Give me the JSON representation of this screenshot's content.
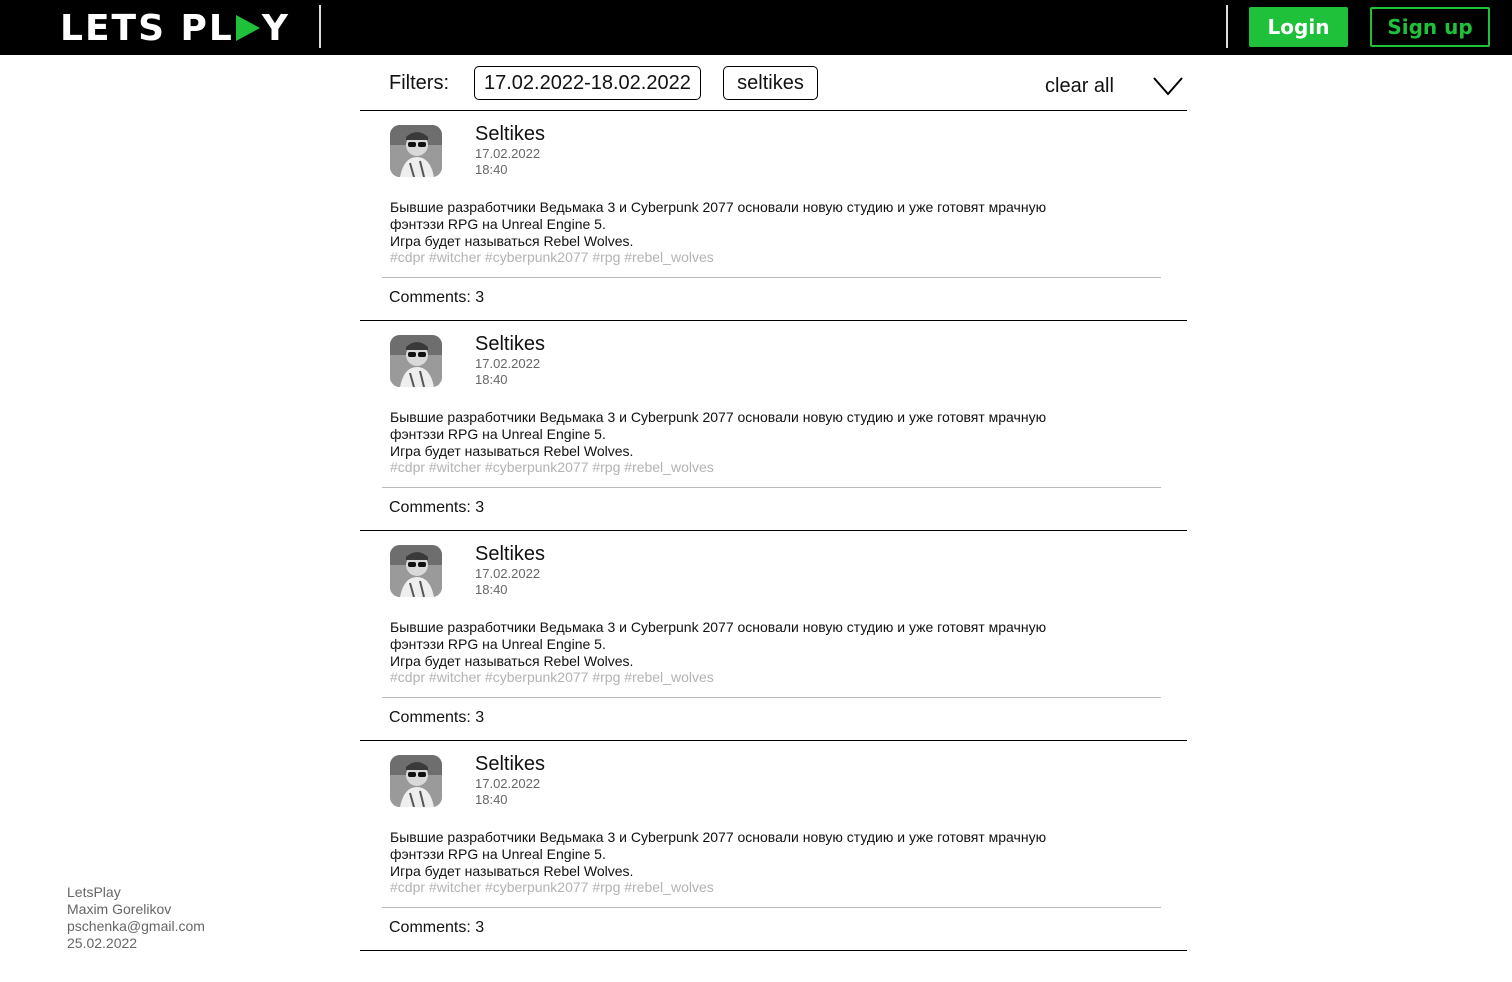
{
  "header": {
    "logo_prefix": "LETS PL",
    "logo_suffix": "Y",
    "login_label": "Login",
    "signup_label": "Sign up",
    "accent_color": "#1fc13a"
  },
  "filters": {
    "label": "Filters:",
    "date_range": "17.02.2022-18.02.2022",
    "user": "seltikes",
    "clear_all_label": "clear all",
    "expand_icon": "chevron-down-icon"
  },
  "posts": [
    {
      "author": "Seltikes",
      "date": "17.02.2022",
      "time": "18:40",
      "body_line1": "Бывшие разработчики Ведьмака 3 и  Cyberpunk 2077 основали новую студию и уже готовят мрачную",
      "body_line2": "фэнтэзи RPG на Unreal Engine 5.",
      "body_line3": "Игра будет называться Rebel Wolves.",
      "tags": "#cdpr #witcher #cyberpunk2077 #rpg #rebel_wolves",
      "comments": "Comments: 3"
    },
    {
      "author": "Seltikes",
      "date": "17.02.2022",
      "time": "18:40",
      "body_line1": "Бывшие разработчики Ведьмака 3 и  Cyberpunk 2077 основали новую студию и уже готовят мрачную",
      "body_line2": "фэнтэзи RPG на Unreal Engine 5.",
      "body_line3": "Игра будет называться Rebel Wolves.",
      "tags": "#cdpr #witcher #cyberpunk2077 #rpg #rebel_wolves",
      "comments": "Comments: 3"
    },
    {
      "author": "Seltikes",
      "date": "17.02.2022",
      "time": "18:40",
      "body_line1": "Бывшие разработчики Ведьмака 3 и  Cyberpunk 2077 основали новую студию и уже готовят мрачную",
      "body_line2": "фэнтэзи RPG на Unreal Engine 5.",
      "body_line3": "Игра будет называться Rebel Wolves.",
      "tags": "#cdpr #witcher #cyberpunk2077 #rpg #rebel_wolves",
      "comments": "Comments: 3"
    },
    {
      "author": "Seltikes",
      "date": "17.02.2022",
      "time": "18:40",
      "body_line1": "Бывшие разработчики Ведьмака 3 и  Cyberpunk 2077 основали новую студию и уже готовят мрачную",
      "body_line2": "фэнтэзи RPG на Unreal Engine 5.",
      "body_line3": "Игра будет называться Rebel Wolves.",
      "tags": "#cdpr #witcher #cyberpunk2077 #rpg #rebel_wolves",
      "comments": "Comments: 3"
    }
  ],
  "footer": {
    "site": "LetsPlay",
    "author": "Maxim Gorelikov",
    "email": "pschenka@gmail.com",
    "date": "25.02.2022"
  }
}
